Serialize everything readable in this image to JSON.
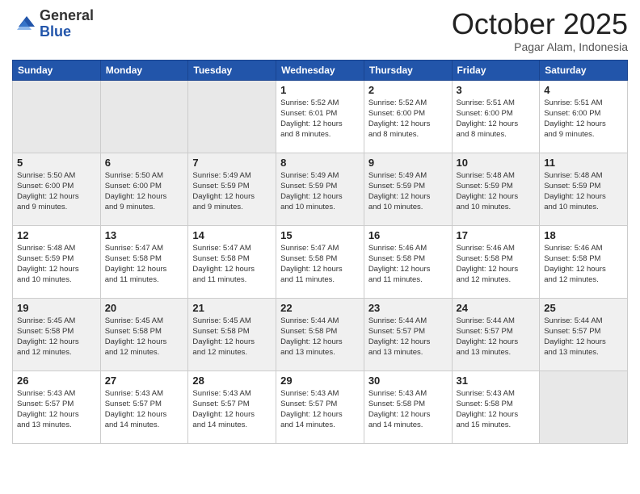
{
  "header": {
    "logo_general": "General",
    "logo_blue": "Blue",
    "month": "October 2025",
    "location": "Pagar Alam, Indonesia"
  },
  "weekdays": [
    "Sunday",
    "Monday",
    "Tuesday",
    "Wednesday",
    "Thursday",
    "Friday",
    "Saturday"
  ],
  "weeks": [
    [
      {
        "day": "",
        "info": ""
      },
      {
        "day": "",
        "info": ""
      },
      {
        "day": "",
        "info": ""
      },
      {
        "day": "1",
        "info": "Sunrise: 5:52 AM\nSunset: 6:01 PM\nDaylight: 12 hours\nand 8 minutes."
      },
      {
        "day": "2",
        "info": "Sunrise: 5:52 AM\nSunset: 6:00 PM\nDaylight: 12 hours\nand 8 minutes."
      },
      {
        "day": "3",
        "info": "Sunrise: 5:51 AM\nSunset: 6:00 PM\nDaylight: 12 hours\nand 8 minutes."
      },
      {
        "day": "4",
        "info": "Sunrise: 5:51 AM\nSunset: 6:00 PM\nDaylight: 12 hours\nand 9 minutes."
      }
    ],
    [
      {
        "day": "5",
        "info": "Sunrise: 5:50 AM\nSunset: 6:00 PM\nDaylight: 12 hours\nand 9 minutes."
      },
      {
        "day": "6",
        "info": "Sunrise: 5:50 AM\nSunset: 6:00 PM\nDaylight: 12 hours\nand 9 minutes."
      },
      {
        "day": "7",
        "info": "Sunrise: 5:49 AM\nSunset: 5:59 PM\nDaylight: 12 hours\nand 9 minutes."
      },
      {
        "day": "8",
        "info": "Sunrise: 5:49 AM\nSunset: 5:59 PM\nDaylight: 12 hours\nand 10 minutes."
      },
      {
        "day": "9",
        "info": "Sunrise: 5:49 AM\nSunset: 5:59 PM\nDaylight: 12 hours\nand 10 minutes."
      },
      {
        "day": "10",
        "info": "Sunrise: 5:48 AM\nSunset: 5:59 PM\nDaylight: 12 hours\nand 10 minutes."
      },
      {
        "day": "11",
        "info": "Sunrise: 5:48 AM\nSunset: 5:59 PM\nDaylight: 12 hours\nand 10 minutes."
      }
    ],
    [
      {
        "day": "12",
        "info": "Sunrise: 5:48 AM\nSunset: 5:59 PM\nDaylight: 12 hours\nand 10 minutes."
      },
      {
        "day": "13",
        "info": "Sunrise: 5:47 AM\nSunset: 5:58 PM\nDaylight: 12 hours\nand 11 minutes."
      },
      {
        "day": "14",
        "info": "Sunrise: 5:47 AM\nSunset: 5:58 PM\nDaylight: 12 hours\nand 11 minutes."
      },
      {
        "day": "15",
        "info": "Sunrise: 5:47 AM\nSunset: 5:58 PM\nDaylight: 12 hours\nand 11 minutes."
      },
      {
        "day": "16",
        "info": "Sunrise: 5:46 AM\nSunset: 5:58 PM\nDaylight: 12 hours\nand 11 minutes."
      },
      {
        "day": "17",
        "info": "Sunrise: 5:46 AM\nSunset: 5:58 PM\nDaylight: 12 hours\nand 12 minutes."
      },
      {
        "day": "18",
        "info": "Sunrise: 5:46 AM\nSunset: 5:58 PM\nDaylight: 12 hours\nand 12 minutes."
      }
    ],
    [
      {
        "day": "19",
        "info": "Sunrise: 5:45 AM\nSunset: 5:58 PM\nDaylight: 12 hours\nand 12 minutes."
      },
      {
        "day": "20",
        "info": "Sunrise: 5:45 AM\nSunset: 5:58 PM\nDaylight: 12 hours\nand 12 minutes."
      },
      {
        "day": "21",
        "info": "Sunrise: 5:45 AM\nSunset: 5:58 PM\nDaylight: 12 hours\nand 12 minutes."
      },
      {
        "day": "22",
        "info": "Sunrise: 5:44 AM\nSunset: 5:58 PM\nDaylight: 12 hours\nand 13 minutes."
      },
      {
        "day": "23",
        "info": "Sunrise: 5:44 AM\nSunset: 5:57 PM\nDaylight: 12 hours\nand 13 minutes."
      },
      {
        "day": "24",
        "info": "Sunrise: 5:44 AM\nSunset: 5:57 PM\nDaylight: 12 hours\nand 13 minutes."
      },
      {
        "day": "25",
        "info": "Sunrise: 5:44 AM\nSunset: 5:57 PM\nDaylight: 12 hours\nand 13 minutes."
      }
    ],
    [
      {
        "day": "26",
        "info": "Sunrise: 5:43 AM\nSunset: 5:57 PM\nDaylight: 12 hours\nand 13 minutes."
      },
      {
        "day": "27",
        "info": "Sunrise: 5:43 AM\nSunset: 5:57 PM\nDaylight: 12 hours\nand 14 minutes."
      },
      {
        "day": "28",
        "info": "Sunrise: 5:43 AM\nSunset: 5:57 PM\nDaylight: 12 hours\nand 14 minutes."
      },
      {
        "day": "29",
        "info": "Sunrise: 5:43 AM\nSunset: 5:57 PM\nDaylight: 12 hours\nand 14 minutes."
      },
      {
        "day": "30",
        "info": "Sunrise: 5:43 AM\nSunset: 5:58 PM\nDaylight: 12 hours\nand 14 minutes."
      },
      {
        "day": "31",
        "info": "Sunrise: 5:43 AM\nSunset: 5:58 PM\nDaylight: 12 hours\nand 15 minutes."
      },
      {
        "day": "",
        "info": ""
      }
    ]
  ]
}
